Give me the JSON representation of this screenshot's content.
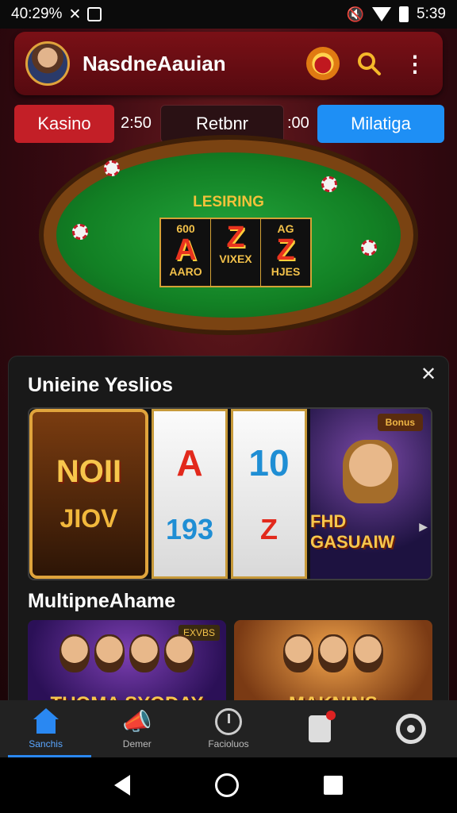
{
  "status_bar": {
    "time": "40:29%",
    "right_time": "5:39"
  },
  "header": {
    "title": "NasdneAauian"
  },
  "tabs": {
    "kasino": "Kasino",
    "time_left": "2:50",
    "middle": "Retbnr",
    "time_right": ":00",
    "right": "Milatiga"
  },
  "table": {
    "label": "LESIRING",
    "reels": [
      {
        "top": "600",
        "big": "A",
        "bottom": "AARO"
      },
      {
        "top": "",
        "big": "Z",
        "bottom": "VIXEX"
      },
      {
        "top": "AG",
        "big": "Z",
        "bottom": "HJES"
      }
    ]
  },
  "panel": {
    "section1_title": "Unieine Yeslios",
    "section2_title": "MultipneAhame",
    "slots": {
      "gold_top": "NOII",
      "gold_bottom": "JIOV",
      "reel1_top": "A",
      "reel1_bottom": "193",
      "reel2_top": "10",
      "reel2_bottom": "Z",
      "promo_badge": "Bonus",
      "promo_title": "FHD GASUAIW"
    },
    "multi": [
      {
        "badge": "EXVBS",
        "title": "TUOMA SYODAY"
      },
      {
        "badge": "",
        "title": "MAKNINS"
      }
    ]
  },
  "bottom_nav": {
    "items": [
      {
        "label": "Sanchis",
        "active": true
      },
      {
        "label": "Demer",
        "active": false
      },
      {
        "label": "Facioluos",
        "active": false
      },
      {
        "label": "",
        "active": false
      },
      {
        "label": "",
        "active": false
      }
    ]
  },
  "colors": {
    "accent_red": "#c31f27",
    "accent_blue": "#1e8ff5",
    "gold": "#f7c64c"
  }
}
